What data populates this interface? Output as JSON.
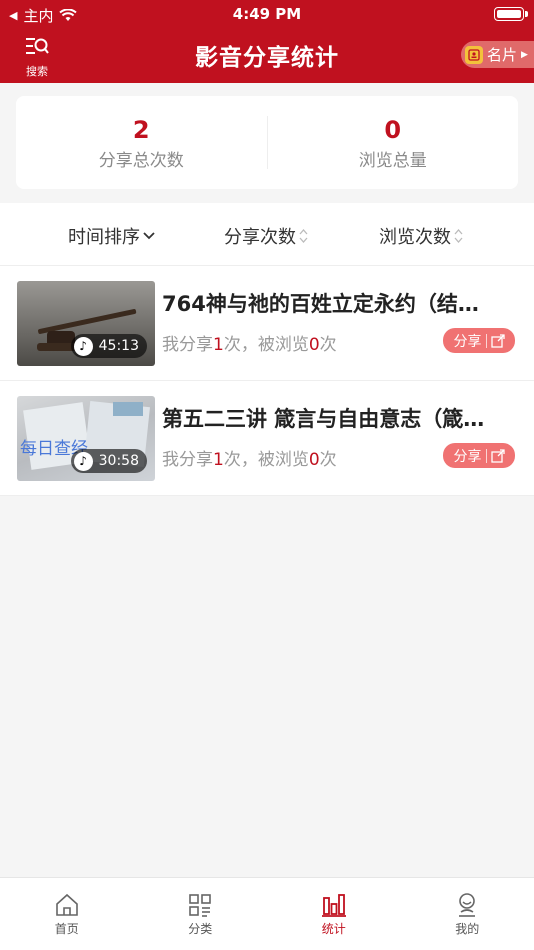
{
  "status": {
    "carrier": "主内",
    "time": "4:49 PM"
  },
  "nav": {
    "search_label": "搜索",
    "title": "影音分享统计",
    "card_label": "名片"
  },
  "summary": {
    "shares": {
      "value": "2",
      "label": "分享总次数"
    },
    "views": {
      "value": "0",
      "label": "浏览总量"
    }
  },
  "sort": {
    "time": "时间排序",
    "shares": "分享次数",
    "views": "浏览次数"
  },
  "items": [
    {
      "title": "764神与祂的百姓立定永约（结…",
      "duration": "45:13",
      "stats_pre": "我分享",
      "share_count": "1",
      "stats_mid": "次，被浏览",
      "view_count": "0",
      "stats_post": "次",
      "share_label": "分享"
    },
    {
      "title": "第五二三讲 箴言与自由意志（箴…",
      "thumb_text": "每日查经",
      "duration": "30:58",
      "stats_pre": "我分享",
      "share_count": "1",
      "stats_mid": "次，被浏览",
      "view_count": "0",
      "stats_post": "次",
      "share_label": "分享"
    }
  ],
  "tabs": [
    {
      "label": "首页",
      "icon": "home-icon"
    },
    {
      "label": "分类",
      "icon": "category-icon"
    },
    {
      "label": "统计",
      "icon": "stats-icon"
    },
    {
      "label": "我的",
      "icon": "profile-icon"
    }
  ],
  "colors": {
    "brand": "#c0111f",
    "share_button": "#f07272"
  }
}
